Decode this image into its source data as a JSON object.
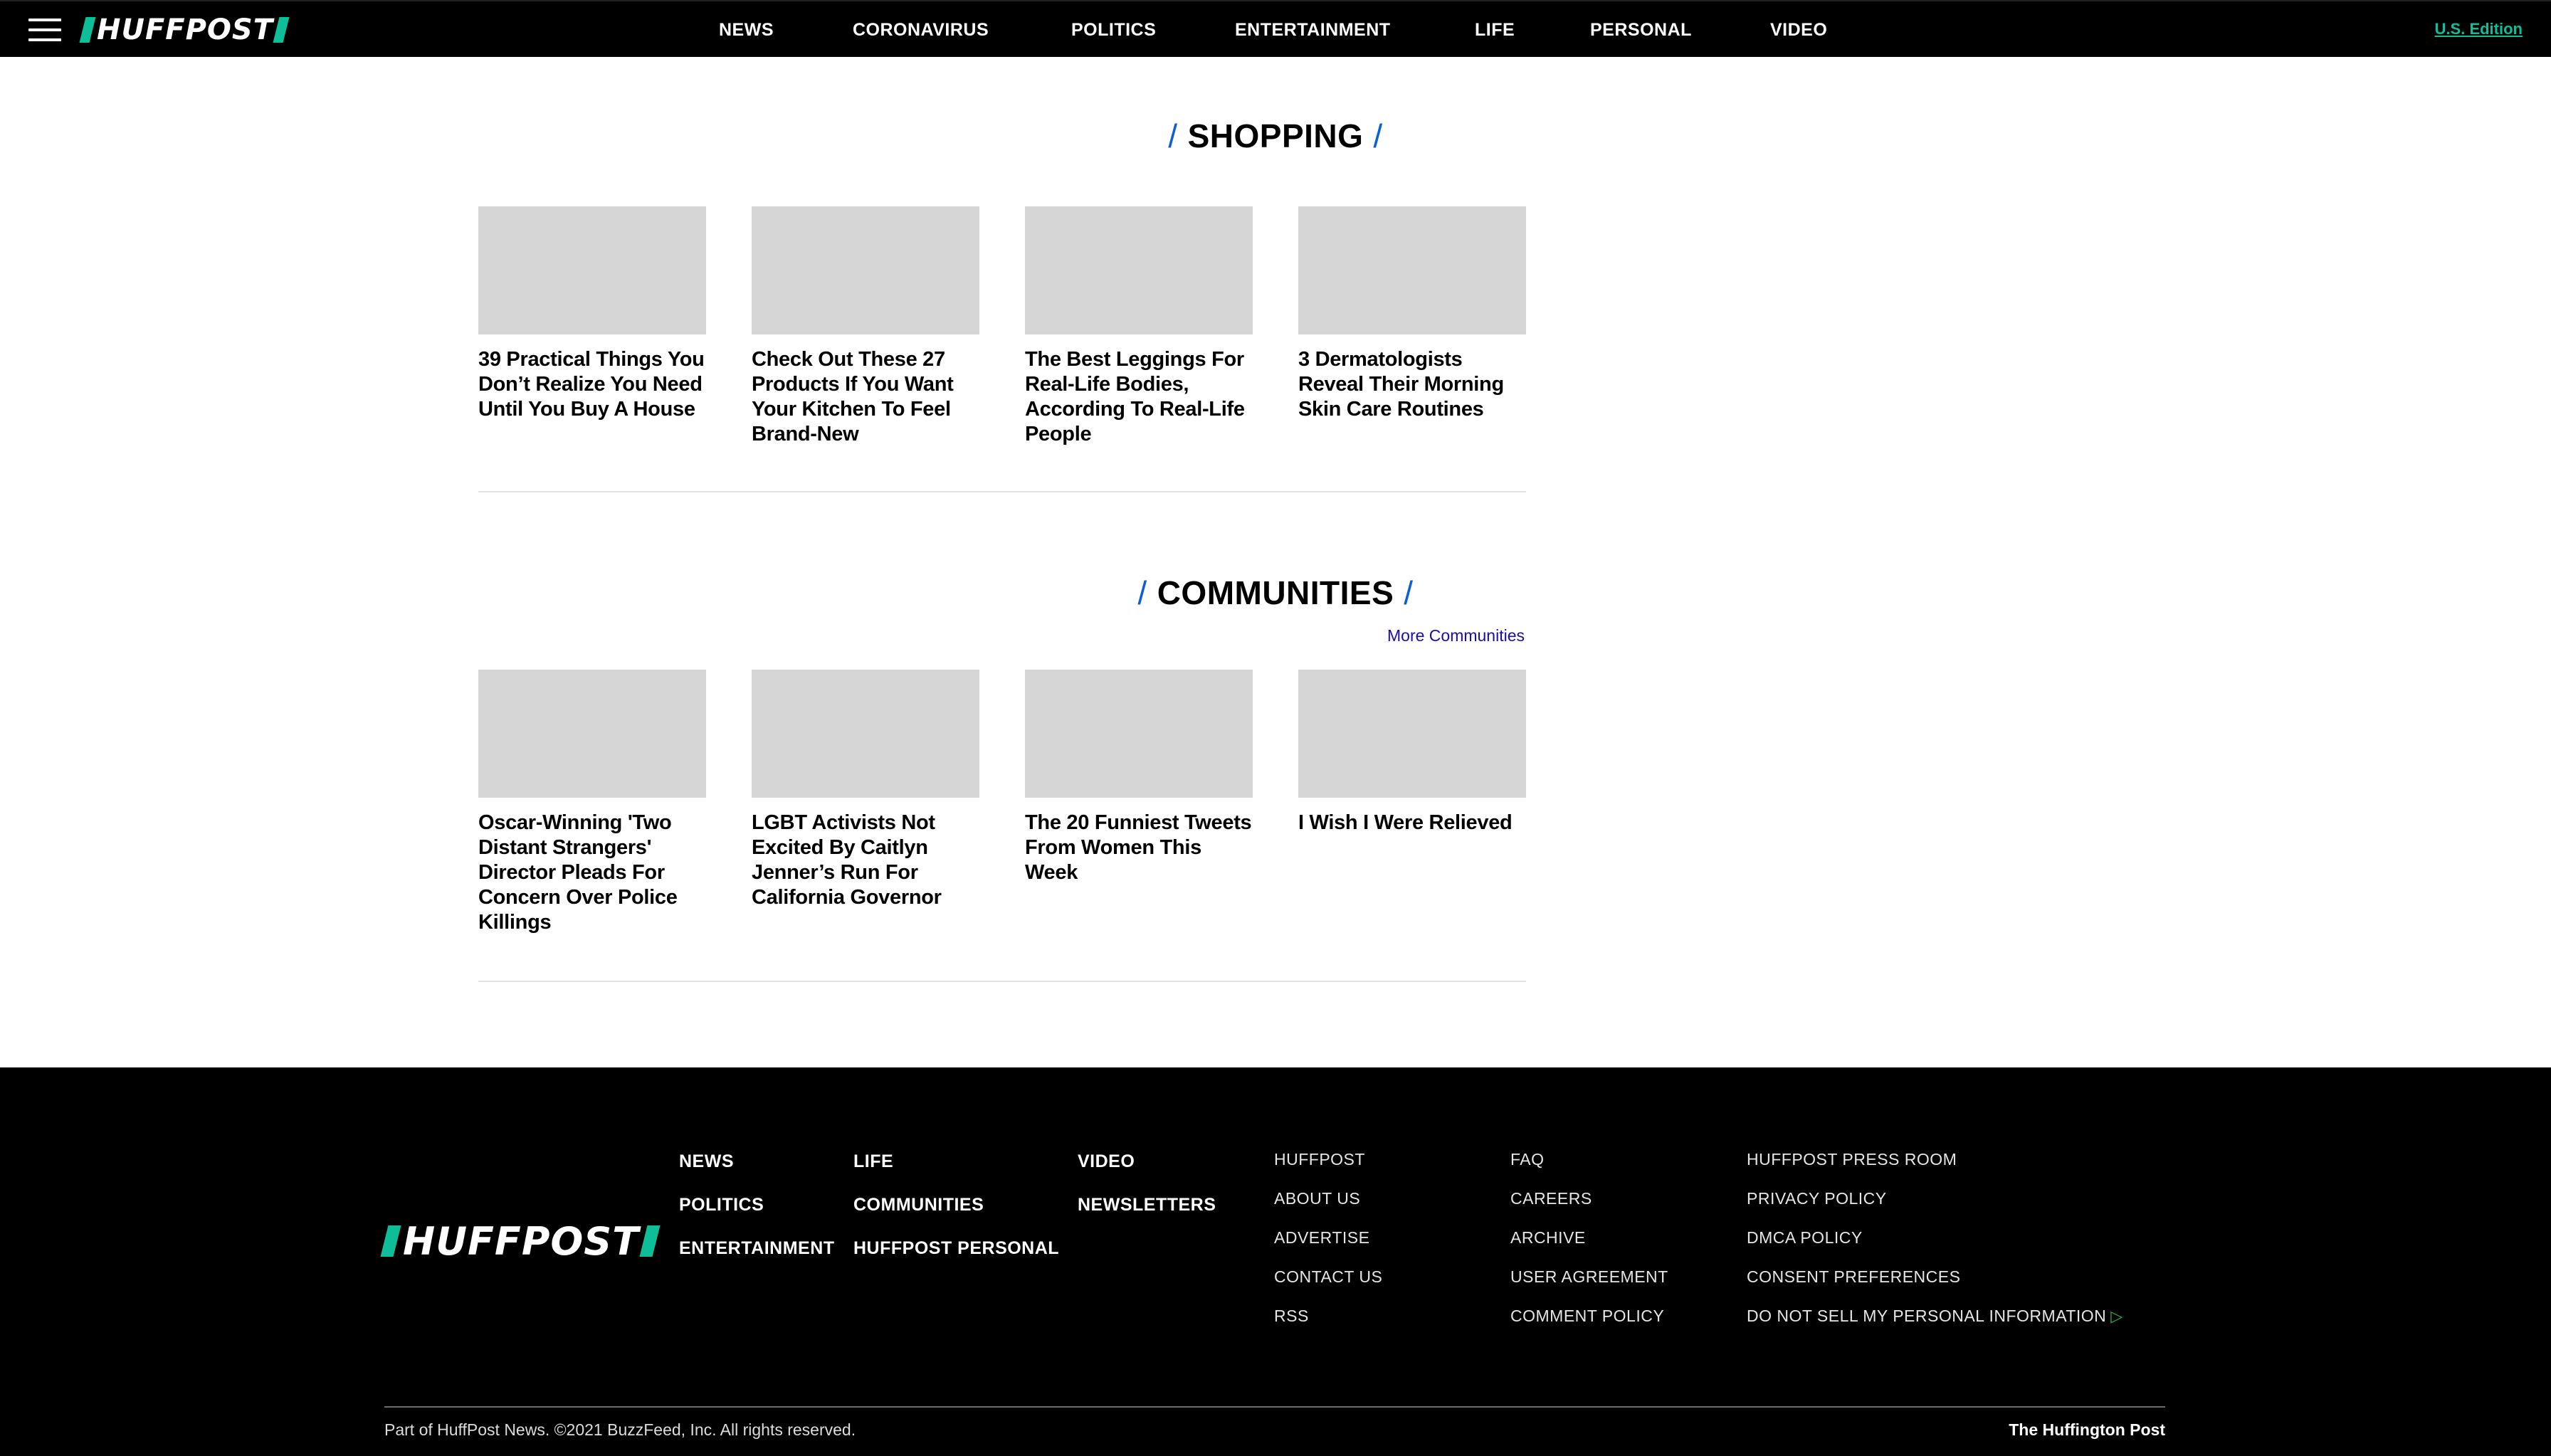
{
  "header": {
    "logo_text": "HUFFPOST",
    "nav": [
      "NEWS",
      "CORONAVIRUS",
      "POLITICS",
      "ENTERTAINMENT",
      "LIFE",
      "PERSONAL",
      "VIDEO"
    ],
    "edition": "U.S. Edition",
    "menu_icon": "hamburger-icon"
  },
  "shopping": {
    "title": "SHOPPING",
    "cards": [
      {
        "headline": "39 Practical Things You Don’t Realize You Need Until You Buy A House"
      },
      {
        "headline": "Check Out These 27 Products If You Want Your Kitchen To Feel Brand-New"
      },
      {
        "headline": "The Best Leggings For Real-Life Bodies, According To Real-Life People"
      },
      {
        "headline": "3 Dermatologists Reveal Their Morning Skin Care Routines"
      }
    ]
  },
  "communities": {
    "title": "COMMUNITIES",
    "more_link": "More Communities",
    "cards": [
      {
        "headline": "Oscar-Winning 'Two Distant Strangers' Director Pleads For Concern Over Police Killings"
      },
      {
        "headline": "LGBT Activists Not Excited By Caitlyn Jenner’s Run For California Governor"
      },
      {
        "headline": "The 20 Funniest Tweets From Women This Week"
      },
      {
        "headline": "I Wish I Were Relieved"
      }
    ]
  },
  "footer": {
    "logo_text": "HUFFPOST",
    "sections": [
      "NEWS",
      "POLITICS",
      "ENTERTAINMENT",
      "LIFE",
      "COMMUNITIES",
      "HUFFPOST PERSONAL",
      "VIDEO",
      "NEWSLETTERS"
    ],
    "links_col1": [
      "HUFFPOST",
      "ABOUT US",
      "ADVERTISE",
      "CONTACT US",
      "RSS"
    ],
    "links_col2": [
      "FAQ",
      "CAREERS",
      "ARCHIVE",
      "USER AGREEMENT",
      "COMMENT POLICY"
    ],
    "links_col3": [
      "HUFFPOST PRESS ROOM",
      "PRIVACY POLICY",
      "DMCA POLICY",
      "CONSENT PREFERENCES",
      "DO NOT SELL MY PERSONAL INFORMATION"
    ],
    "copyright": "Part of HuffPost News. ©2021 BuzzFeed, Inc. All rights reserved.",
    "corp": "The Huffington Post",
    "colors": {
      "accent": "#0dbe98",
      "slash": "#0a5fd8",
      "privacy_arrow": "#27b34b"
    }
  }
}
